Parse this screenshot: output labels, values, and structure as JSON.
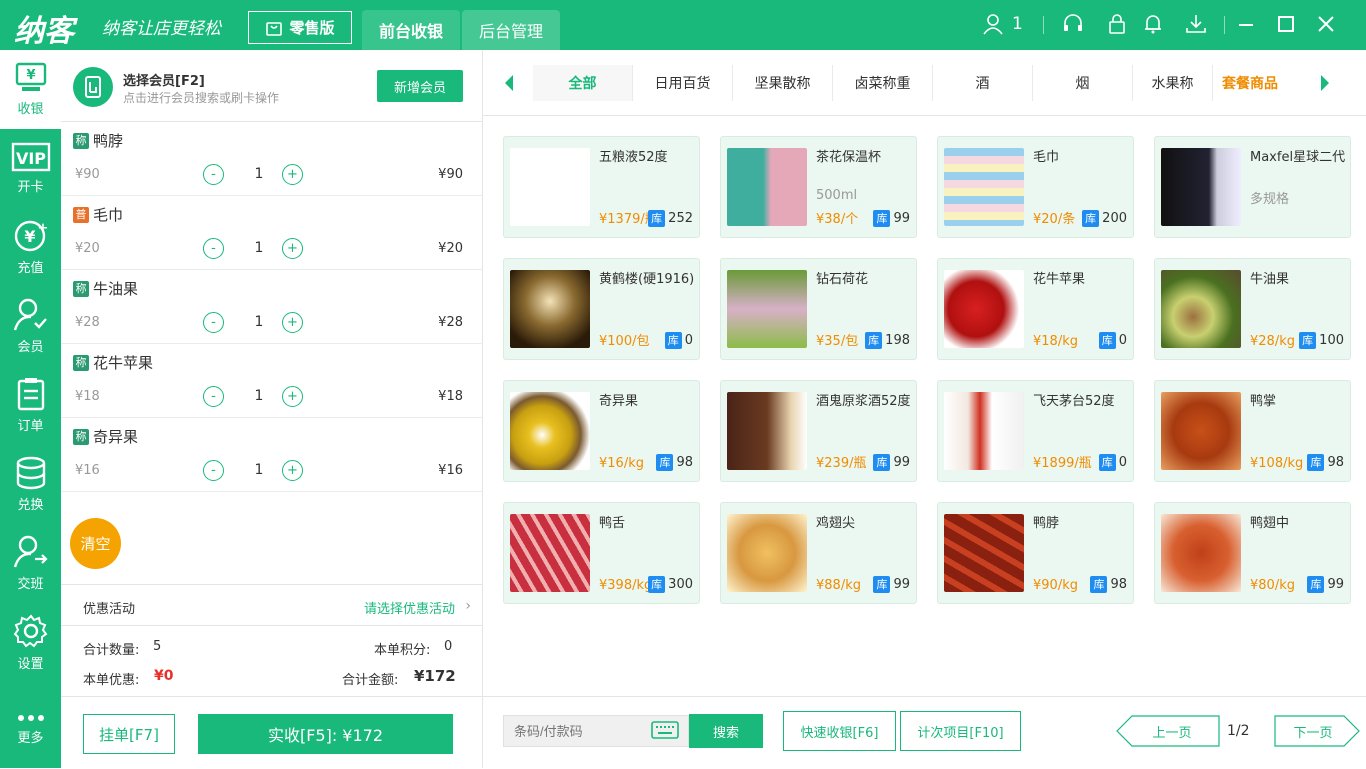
{
  "app": {
    "logo": "纳客",
    "slogan": "纳客让店更轻松",
    "edition": "零售版",
    "tabs": [
      "前台收银",
      "后台管理"
    ],
    "user_count": "1"
  },
  "sidebar": [
    {
      "label": "收银",
      "icon": "cashier-icon",
      "active": true
    },
    {
      "label": "开卡",
      "icon": "vip-card-icon"
    },
    {
      "label": "充值",
      "icon": "recharge-icon"
    },
    {
      "label": "会员",
      "icon": "member-icon"
    },
    {
      "label": "订单",
      "icon": "order-icon"
    },
    {
      "label": "兑换",
      "icon": "exchange-icon"
    },
    {
      "label": "交班",
      "icon": "shift-icon"
    },
    {
      "label": "设置",
      "icon": "settings-icon"
    },
    {
      "label": "更多",
      "icon": "more-icon"
    }
  ],
  "member": {
    "title": "选择会员[F2]",
    "hint": "点击进行会员搜索或刷卡操作",
    "add_button": "新增会员"
  },
  "cart": [
    {
      "tag": "称",
      "name": "鸭脖",
      "price": "¥90",
      "qty": "1",
      "subtotal": "¥90"
    },
    {
      "tag": "普",
      "name": "毛巾",
      "price": "¥20",
      "qty": "1",
      "subtotal": "¥20"
    },
    {
      "tag": "称",
      "name": "牛油果",
      "price": "¥28",
      "qty": "1",
      "subtotal": "¥28"
    },
    {
      "tag": "称",
      "name": "花牛苹果",
      "price": "¥18",
      "qty": "1",
      "subtotal": "¥18"
    },
    {
      "tag": "称",
      "name": "奇异果",
      "price": "¥16",
      "qty": "1",
      "subtotal": "¥16"
    }
  ],
  "qty_minus": "-",
  "qty_plus": "+",
  "clear_button": "清空",
  "promo": {
    "label": "优惠活动",
    "select": "请选择优惠活动"
  },
  "summary": {
    "qty_label": "合计数量:",
    "qty": "5",
    "points_label": "本单积分:",
    "points": "0",
    "discount_label": "本单优惠:",
    "discount": "¥0",
    "total_label": "合计金额:",
    "total": "¥172"
  },
  "actions": {
    "hold": "挂单[F7]",
    "pay": "实收[F5]: ¥172"
  },
  "categories": [
    "全部",
    "日用百货",
    "坚果散称",
    "卤菜称重",
    "酒",
    "烟",
    "水果称",
    "套餐商品"
  ],
  "stock_tag": "库",
  "products": [
    {
      "name": "五粮液52度",
      "spec": "",
      "price": "¥1379/瓶",
      "stock": "252",
      "img": "liquor"
    },
    {
      "name": "茶花保温杯",
      "spec": "500ml",
      "price": "¥38/个",
      "stock": "99",
      "img": "cup"
    },
    {
      "name": "毛巾",
      "spec": "",
      "price": "¥20/条",
      "stock": "200",
      "img": "towel"
    },
    {
      "name": "Maxfel星球二代",
      "spec": "多规格",
      "price": "",
      "stock": "",
      "img": "device"
    },
    {
      "name": "黄鹤楼(硬1916)",
      "spec": "",
      "price": "¥100/包",
      "stock": "0",
      "img": "cigarette"
    },
    {
      "name": "钻石荷花",
      "spec": "",
      "price": "¥35/包",
      "stock": "198",
      "img": "lotus"
    },
    {
      "name": "花牛苹果",
      "spec": "",
      "price": "¥18/kg",
      "stock": "0",
      "img": "apple"
    },
    {
      "name": "牛油果",
      "spec": "",
      "price": "¥28/kg",
      "stock": "100",
      "img": "avocado"
    },
    {
      "name": "奇异果",
      "spec": "",
      "price": "¥16/kg",
      "stock": "98",
      "img": "kiwi"
    },
    {
      "name": "酒鬼原浆酒52度",
      "spec": "",
      "price": "¥239/瓶",
      "stock": "99",
      "img": "jiugui"
    },
    {
      "name": "飞天茅台52度",
      "spec": "",
      "price": "¥1899/瓶",
      "stock": "0",
      "img": "maotai"
    },
    {
      "name": "鸭掌",
      "spec": "",
      "price": "¥108/kg",
      "stock": "98",
      "img": "duck"
    },
    {
      "name": "鸭舌",
      "spec": "",
      "price": "¥398/kg",
      "stock": "300",
      "img": "ducktongue"
    },
    {
      "name": "鸡翅尖",
      "spec": "",
      "price": "¥88/kg",
      "stock": "99",
      "img": "wing"
    },
    {
      "name": "鸭脖",
      "spec": "",
      "price": "¥90/kg",
      "stock": "98",
      "img": "duckneck"
    },
    {
      "name": "鸭翅中",
      "spec": "",
      "price": "¥80/kg",
      "stock": "99",
      "img": "duckwing"
    }
  ],
  "bottom": {
    "barcode_placeholder": "条码/付款码",
    "search": "搜索",
    "quick": "快速收银[F6]",
    "count_items": "计次项目[F10]",
    "prev": "上一页",
    "page": "1/2",
    "next": "下一页"
  },
  "colors": {
    "primary": "#19b97c",
    "price": "#f08c00",
    "stock_tag": "#1e8cf0",
    "clear": "#f5a300",
    "discount": "#e8302a"
  }
}
